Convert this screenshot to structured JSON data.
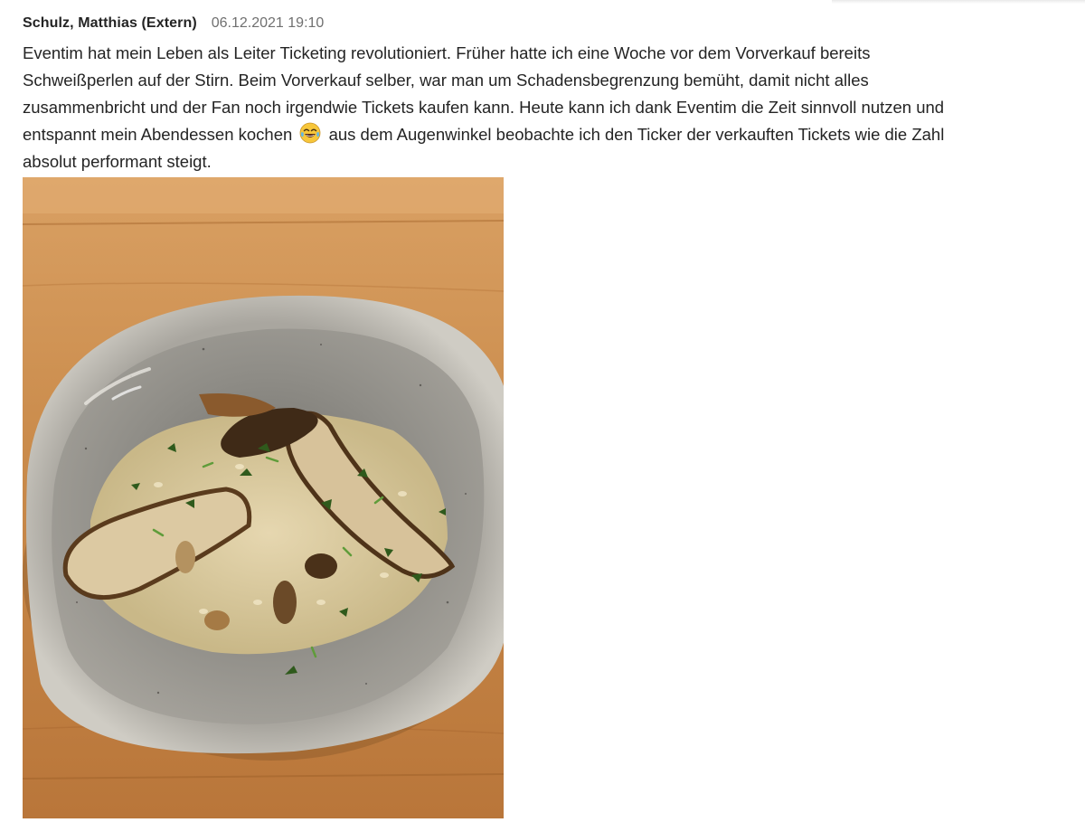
{
  "message": {
    "author": "Schulz, Matthias (Extern)",
    "timestamp": "06.12.2021 19:10",
    "lines": [
      "Eventim hat mein Leben als Leiter Ticketing revolutioniert. Früher hatte ich eine Woche vor dem Vorverkauf bereits",
      "Schweißperlen auf der Stirn. Beim Vorverkauf selber, war man um Schadensbegrenzung bemüht, damit nicht alles",
      "zusammenbricht und der Fan noch irgendwie Tickets kaufen kann. Heute kann ich dank Eventim die Zeit sinnvoll nutzen und",
      "absolut performant steigt."
    ],
    "line4_before": "entspannt mein Abendessen kochen",
    "line4_after": "aus dem Augenwinkel beobachte ich den Ticker der verkauften Tickets wie die Zahl",
    "emoji_icon": "face-with-tears-of-joy-icon",
    "image_icon": "risotto-photo"
  },
  "colors": {
    "text": "#242424",
    "timestamp": "#707070",
    "wood": "#c98a4a",
    "plate": "#8c8a84"
  }
}
